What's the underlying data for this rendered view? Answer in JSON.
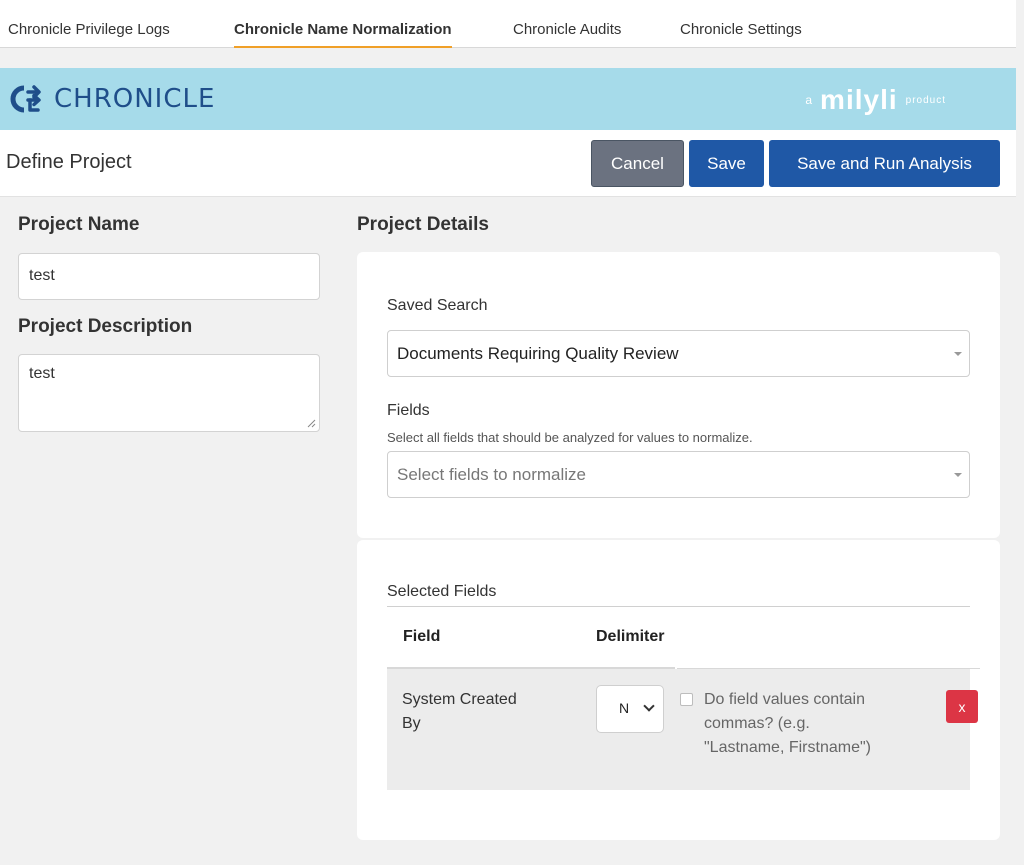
{
  "tabs": [
    {
      "label": "Chronicle Privilege Logs"
    },
    {
      "label": "Chronicle Name Normalization"
    },
    {
      "label": "Chronicle Audits"
    },
    {
      "label": "Chronicle Settings"
    }
  ],
  "brand": {
    "logo_text": "CHRONICLE",
    "by_prefix": "a",
    "by_name": "milyli",
    "by_suffix": "product",
    "color": "#a6dbea"
  },
  "header": {
    "title": "Define Project",
    "cancel_label": "Cancel",
    "save_label": "Save",
    "run_label": "Save and Run Analysis"
  },
  "project": {
    "name_label": "Project Name",
    "name_value": "test",
    "description_label": "Project Description",
    "description_value": "test"
  },
  "details": {
    "heading": "Project Details",
    "saved_search_label": "Saved Search",
    "saved_search_value": "Documents Requiring Quality Review",
    "fields_label": "Fields",
    "fields_hint": "Select all fields that should be analyzed for values to normalize.",
    "fields_placeholder": "Select fields to normalize"
  },
  "selected_fields": {
    "heading": "Selected Fields",
    "columns": {
      "field": "Field",
      "delimiter": "Delimiter"
    },
    "rows": [
      {
        "field_line1": "System Created",
        "field_line2": "By",
        "delimiter": "N",
        "comma_line1": "Do field values contain",
        "comma_line2": "commas? (e.g.",
        "comma_line3": "\"Lastname, Firstname\")",
        "delete_label": "x"
      }
    ]
  },
  "colors": {
    "accent": "#f0a028",
    "primary": "#1f58a6",
    "danger": "#dc3545"
  }
}
